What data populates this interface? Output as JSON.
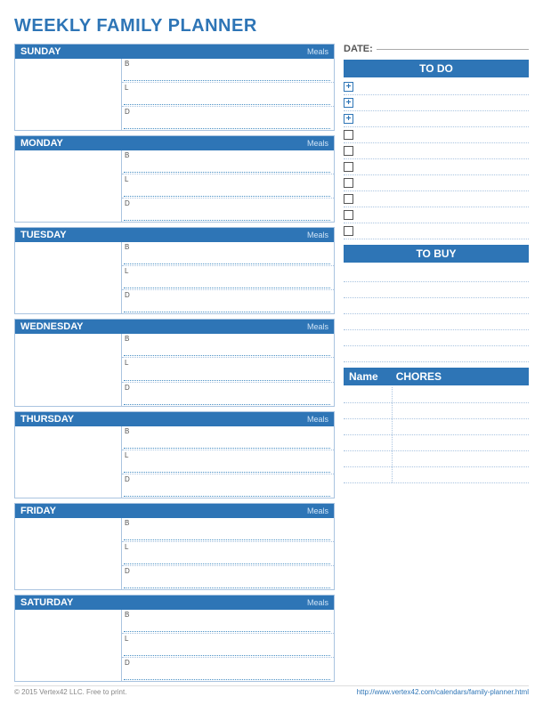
{
  "title": "WEEKLY FAMILY PLANNER",
  "date_label": "DATE:",
  "days": [
    {
      "name": "SUNDAY",
      "meals_label": "Meals",
      "meal_labels": [
        "B",
        "L",
        "D"
      ]
    },
    {
      "name": "MONDAY",
      "meals_label": "Meals",
      "meal_labels": [
        "B",
        "L",
        "D"
      ]
    },
    {
      "name": "TUESDAY",
      "meals_label": "Meals",
      "meal_labels": [
        "B",
        "L",
        "D"
      ]
    },
    {
      "name": "WEDNESDAY",
      "meals_label": "Meals",
      "meal_labels": [
        "B",
        "L",
        "D"
      ]
    },
    {
      "name": "THURSDAY",
      "meals_label": "Meals",
      "meal_labels": [
        "B",
        "L",
        "D"
      ]
    },
    {
      "name": "FRIDAY",
      "meals_label": "Meals",
      "meal_labels": [
        "B",
        "L",
        "D"
      ]
    },
    {
      "name": "SATURDAY",
      "meals_label": "Meals",
      "meal_labels": [
        "B",
        "L",
        "D"
      ]
    }
  ],
  "todo": {
    "header": "TO DO",
    "items": [
      {
        "type": "plus",
        "text": ""
      },
      {
        "type": "plus",
        "text": ""
      },
      {
        "type": "plus",
        "text": ""
      },
      {
        "type": "square",
        "text": ""
      },
      {
        "type": "square",
        "text": ""
      },
      {
        "type": "square",
        "text": ""
      },
      {
        "type": "square",
        "text": ""
      },
      {
        "type": "square",
        "text": ""
      },
      {
        "type": "square",
        "text": ""
      },
      {
        "type": "square",
        "text": ""
      }
    ]
  },
  "tobuy": {
    "header": "TO BUY",
    "lines": 6
  },
  "chores": {
    "name_label": "Name",
    "header": "CHORES",
    "rows": 6
  },
  "footer": {
    "copyright": "© 2015 Vertex42 LLC. Free to print.",
    "url": "http://www.vertex42.com/calendars/family-planner.html"
  }
}
